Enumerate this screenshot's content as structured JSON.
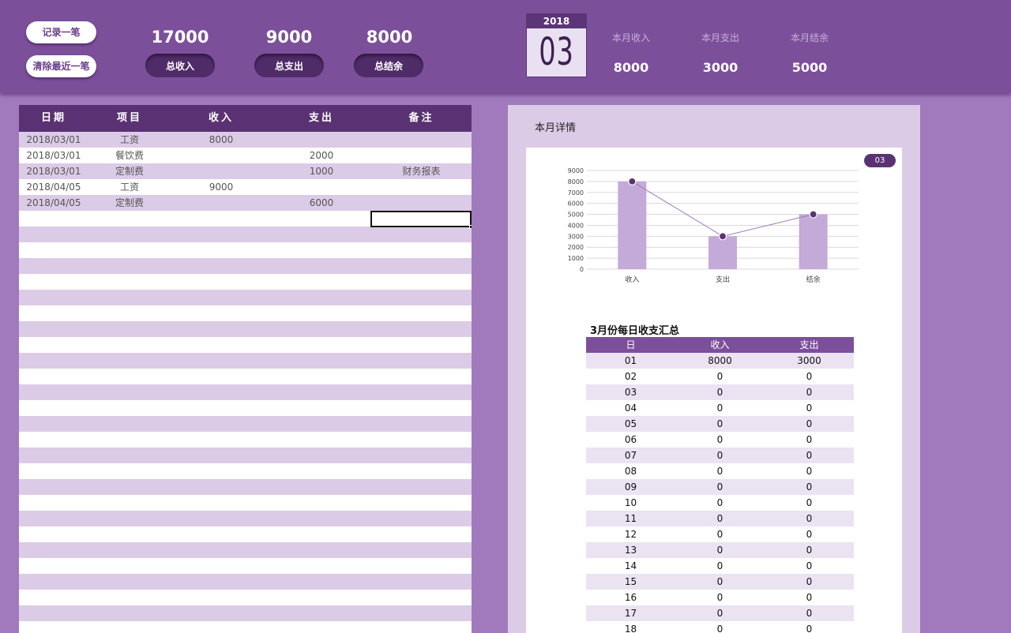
{
  "header": {
    "record_btn": "记录一笔",
    "clear_btn": "清除最近一笔",
    "totals": [
      {
        "value": "17000",
        "label": "总收入"
      },
      {
        "value": "9000",
        "label": "总支出"
      },
      {
        "value": "8000",
        "label": "总结余"
      }
    ],
    "calendar": {
      "year": "2018",
      "month": "03"
    },
    "month_stats": [
      {
        "label": "本月收入",
        "value": "8000"
      },
      {
        "label": "本月支出",
        "value": "3000"
      },
      {
        "label": "本月结余",
        "value": "5000"
      }
    ]
  },
  "ledger": {
    "columns": [
      "日期",
      "项目",
      "收入",
      "支出",
      "备注"
    ],
    "rows": [
      [
        "2018/03/01",
        "工资",
        "8000",
        "",
        ""
      ],
      [
        "2018/03/01",
        "餐饮费",
        "",
        "2000",
        ""
      ],
      [
        "2018/03/01",
        "定制费",
        "",
        "1000",
        "财务报表"
      ],
      [
        "2018/04/05",
        "工资",
        "9000",
        "",
        ""
      ],
      [
        "2018/04/05",
        "定制费",
        "",
        "6000",
        ""
      ]
    ]
  },
  "detail": {
    "title": "本月详情",
    "month_badge": "03",
    "table_title": "3月份每日收支汇总",
    "table_columns": [
      "日",
      "收入",
      "支出"
    ],
    "table_rows": [
      [
        "01",
        "8000",
        "3000"
      ],
      [
        "02",
        "0",
        "0"
      ],
      [
        "03",
        "0",
        "0"
      ],
      [
        "04",
        "0",
        "0"
      ],
      [
        "05",
        "0",
        "0"
      ],
      [
        "06",
        "0",
        "0"
      ],
      [
        "07",
        "0",
        "0"
      ],
      [
        "08",
        "0",
        "0"
      ],
      [
        "09",
        "0",
        "0"
      ],
      [
        "10",
        "0",
        "0"
      ],
      [
        "11",
        "0",
        "0"
      ],
      [
        "12",
        "0",
        "0"
      ],
      [
        "13",
        "0",
        "0"
      ],
      [
        "14",
        "0",
        "0"
      ],
      [
        "15",
        "0",
        "0"
      ],
      [
        "16",
        "0",
        "0"
      ],
      [
        "17",
        "0",
        "0"
      ],
      [
        "18",
        "0",
        "0"
      ]
    ]
  },
  "chart_data": {
    "type": "bar",
    "categories": [
      "收入",
      "支出",
      "结余"
    ],
    "values": [
      8000,
      3000,
      5000
    ],
    "line_values": [
      8000,
      3000,
      5000
    ],
    "ylim": [
      0,
      9000
    ],
    "yticks": [
      0,
      1000,
      2000,
      3000,
      4000,
      5000,
      6000,
      7000,
      8000,
      9000
    ],
    "grid": true,
    "bar_color": "#c4aad8",
    "line_color": "#a07abc",
    "marker_color": "#5a3274"
  }
}
